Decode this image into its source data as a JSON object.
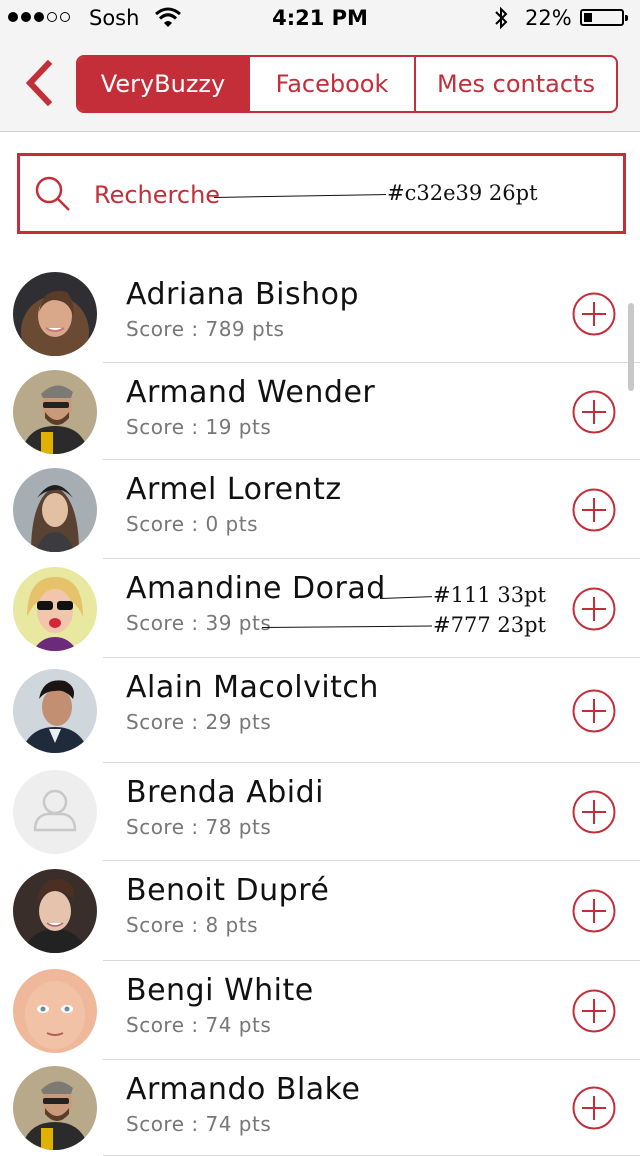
{
  "status_bar": {
    "carrier": "Sosh",
    "time": "4:21 PM",
    "battery": "22%",
    "signal_icon": "signal-dots-icon",
    "wifi_icon": "wifi-icon",
    "bluetooth_icon": "bluetooth-icon"
  },
  "nav": {
    "back_icon": "chevron-left-icon",
    "tabs": [
      {
        "label": "VeryBuzzy",
        "active": true
      },
      {
        "label": "Facebook",
        "active": false
      },
      {
        "label": "Mes contacts",
        "active": false
      }
    ]
  },
  "search": {
    "placeholder": "Recherche",
    "icon": "search-icon",
    "annotation": "#c32e39  26pt"
  },
  "annotations": {
    "name_spec": "#111  33pt",
    "score_spec": "#777  23pt"
  },
  "contacts": [
    {
      "name": "Adriana Bishop",
      "score": "Score : 789 pts"
    },
    {
      "name": "Armand Wender",
      "score": "Score : 19 pts"
    },
    {
      "name": "Armel Lorentz",
      "score": "Score : 0 pts"
    },
    {
      "name": "Amandine Dorad",
      "score": "Score : 39 pts"
    },
    {
      "name": "Alain Macolvitch",
      "score": "Score : 29 pts"
    },
    {
      "name": "Brenda Abidi",
      "score": "Score : 78 pts"
    },
    {
      "name": "Benoit Dupré",
      "score": "Score : 8 pts"
    },
    {
      "name": "Bengi White",
      "score": "Score : 74 pts"
    },
    {
      "name": "Armando Blake",
      "score": "Score : 74 pts"
    }
  ],
  "colors": {
    "accent": "#c32e39",
    "name_text": "#111111",
    "score_text": "#777777"
  }
}
